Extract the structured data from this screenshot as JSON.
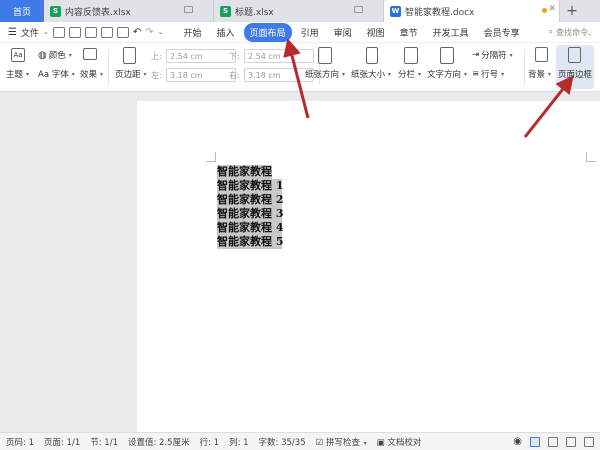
{
  "tabs": {
    "home": "首页",
    "files": [
      {
        "name": "内容反馈表.xlsx",
        "type": "xls"
      },
      {
        "name": "标题.xlsx",
        "type": "xls"
      },
      {
        "name": "智能家教程.docx",
        "type": "doc"
      }
    ],
    "add": "+"
  },
  "menu": {
    "file": "文件",
    "tabs": [
      "开始",
      "插入",
      "页面布局",
      "引用",
      "审阅",
      "视图",
      "章节",
      "开发工具",
      "会员专享"
    ],
    "search": "查找命令、"
  },
  "ribbon": {
    "theme": "主题",
    "colors": "颜色",
    "fonts": "Aa 字体",
    "effects": "效果",
    "margins": "页边距",
    "top_label": "上:",
    "top_value": "2.54 cm",
    "bottom_label": "下:",
    "bottom_value": "2.54 cm",
    "left_label": "左:",
    "left_value": "3.18 cm",
    "right_label": "右:",
    "right_value": "3.18 cm",
    "orientation": "纸张方向",
    "size": "纸张大小",
    "columns": "分栏",
    "text_direction": "文字方向",
    "breaks": "分隔符",
    "line_numbers": "行号",
    "background": "背景",
    "page_borders": "页面边框"
  },
  "document": {
    "lines": [
      "智能家教程",
      "智能家教程 1",
      "智能家教程 2",
      "智能家教程 3",
      "智能家教程 4",
      "智能家教程 5"
    ]
  },
  "status": {
    "page_num": "页码: 1",
    "pages": "页面: 1/1",
    "section": "节: 1/1",
    "setting": "设置值: 2.5厘米",
    "row": "行: 1",
    "col": "列: 1",
    "word_count": "字数: 35/35",
    "spell": "拼写检查",
    "proof": "文档校对"
  },
  "colors": {
    "accent": "#3f7ae8",
    "arrow": "#b52a2a",
    "selection": "#c8c8c8"
  }
}
